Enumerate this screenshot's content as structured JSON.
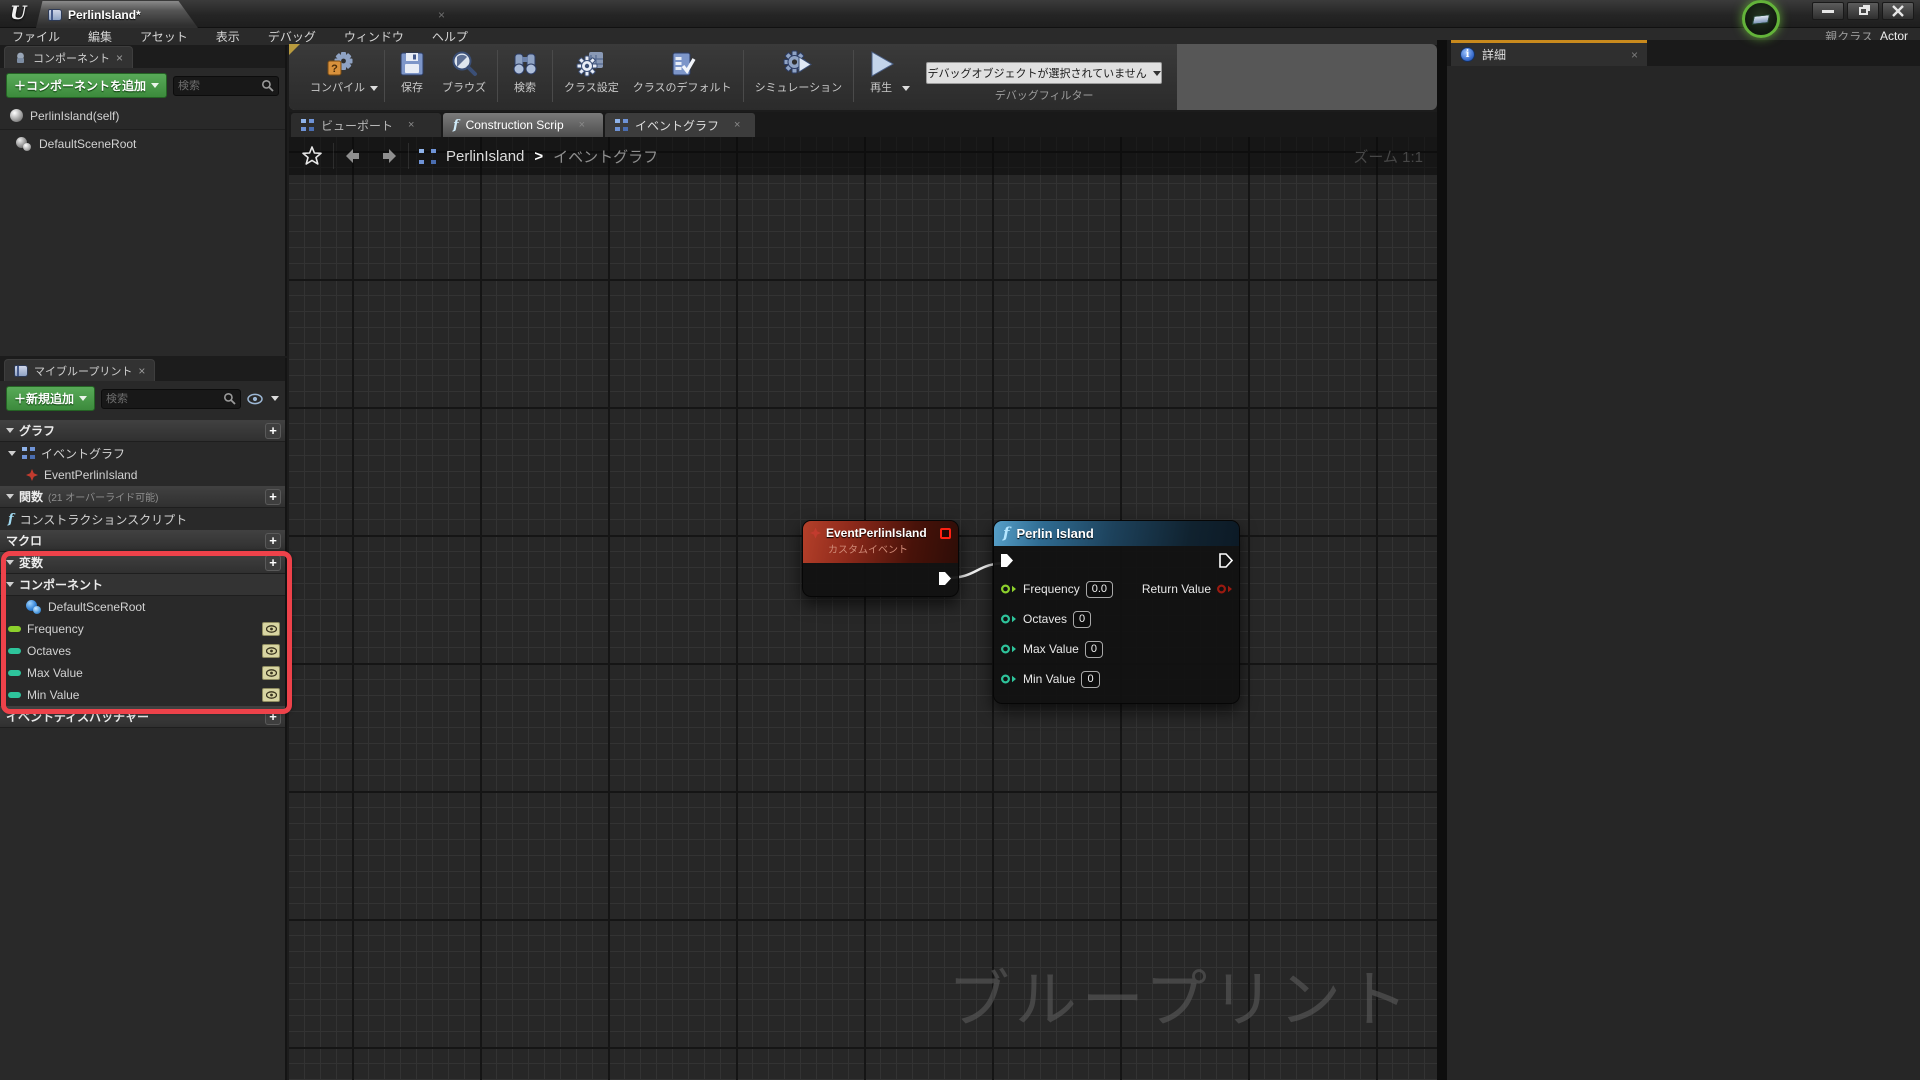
{
  "titlebar": {
    "tab_title": "PerlinIsland*"
  },
  "menubar": {
    "items": [
      "ファイル",
      "編集",
      "アセット",
      "表示",
      "デバッグ",
      "ウィンドウ",
      "ヘルプ"
    ],
    "parent_class_label": "親クラス",
    "parent_class_value": "Actor"
  },
  "toolbar": {
    "compile": "コンパイル",
    "save": "保存",
    "browse": "ブラウズ",
    "find": "検索",
    "class_settings": "クラス設定",
    "class_defaults": "クラスのデフォルト",
    "simulate": "シミュレーション",
    "play": "再生",
    "debug_object": "デバッグオブジェクトが選択されていません",
    "debug_filter": "デバッグフィルター"
  },
  "components_panel": {
    "tab": "コンポーネント",
    "add_button": "＋コンポーネントを追加",
    "search_placeholder": "検索",
    "self_item": "PerlinIsland(self)",
    "scene_root": "DefaultSceneRoot"
  },
  "my_blueprint": {
    "tab": "マイブループリント",
    "add_button": "＋新規追加",
    "search_placeholder": "検索",
    "graph_header": "グラフ",
    "event_graph": "イベントグラフ",
    "event_item": "EventPerlinIsland",
    "functions_header": "関数",
    "functions_note": "(21 オーバーライド可能)",
    "construction_script": "コンストラクションスクリプト",
    "macro_header": "マクロ",
    "variables_header": "変数",
    "components_header": "コンポーネント",
    "scene_root": "DefaultSceneRoot",
    "var_frequency": "Frequency",
    "var_octaves": "Octaves",
    "var_max_value": "Max Value",
    "var_min_value": "Min Value",
    "dispatcher_header": "イベントディスパッチャー"
  },
  "doc_tabs": {
    "viewport": "ビューポート",
    "construction": "Construction Scrip",
    "event_graph": "イベントグラフ"
  },
  "breadcrumb": {
    "root": "PerlinIsland",
    "separator": ">",
    "current": "イベントグラフ",
    "zoom_label": "ズーム 1:1"
  },
  "graph": {
    "watermark": "ブループリント",
    "event_node": {
      "title": "EventPerlinIsland",
      "subtitle": "カスタムイベント"
    },
    "function_node": {
      "f_glyph": "f",
      "title": "Perlin Island",
      "pin_frequency": "Frequency",
      "value_frequency": "0.0",
      "pin_octaves": "Octaves",
      "value_octaves": "0",
      "pin_max": "Max Value",
      "value_max": "0",
      "pin_min": "Min Value",
      "value_min": "0",
      "pin_return": "Return Value"
    }
  },
  "details_panel": {
    "tab": "詳細"
  },
  "ui": {
    "plus": "+",
    "close": "×",
    "fn_glyph": "f"
  },
  "colors": {
    "highlight_red": "#ee424a",
    "accent_green": "#3c8a3c",
    "float_pin": "#8cd02c",
    "int_pin": "#2ec49b",
    "return_pin": "#9b1a10",
    "event_header": "#8e2a1b",
    "function_header": "#2f6b91",
    "details_tab_accent": "#c98a1d"
  }
}
